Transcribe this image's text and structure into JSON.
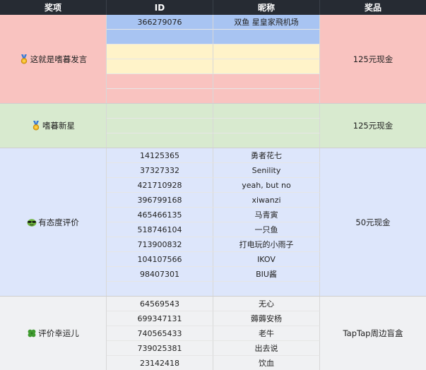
{
  "header": {
    "award": "奖项",
    "id": "ID",
    "nickname": "昵称",
    "prize": "奖品"
  },
  "colors": {
    "header_bg": "#262b33",
    "group1_bg": "#f9c3c0",
    "group2_bg": "#d8eacf",
    "group3_bg": "#dde6fb",
    "group4_bg": "#f0f1f3",
    "row_highlight_blue": "#a8c4f2",
    "row_highlight_yellow": "#fff3c9"
  },
  "groups": [
    {
      "award": "这就是嗜暮发言",
      "award_icon": "medal-icon",
      "prize": "125元现金",
      "rows": [
        {
          "id": "366279076",
          "nickname": "双鱼 星皇家飛机场"
        },
        {
          "id": "",
          "nickname": ""
        },
        {
          "id": "",
          "nickname": ""
        },
        {
          "id": "",
          "nickname": ""
        },
        {
          "id": "",
          "nickname": ""
        },
        {
          "id": "",
          "nickname": ""
        }
      ]
    },
    {
      "award": "嗜暮新星",
      "award_icon": "medal-icon",
      "prize": "125元现金",
      "rows": [
        {
          "id": "",
          "nickname": ""
        },
        {
          "id": "",
          "nickname": ""
        },
        {
          "id": "",
          "nickname": ""
        }
      ]
    },
    {
      "award": "有态度评价",
      "award_icon": "sunglasses-face-icon",
      "prize": "50元现金",
      "rows": [
        {
          "id": "14125365",
          "nickname": "勇者花七"
        },
        {
          "id": "37327332",
          "nickname": "Senility"
        },
        {
          "id": "421710928",
          "nickname": "yeah, but no"
        },
        {
          "id": "396799168",
          "nickname": "xiwanzi"
        },
        {
          "id": "465466135",
          "nickname": "马青寅"
        },
        {
          "id": "518746104",
          "nickname": "一只鱼"
        },
        {
          "id": "713900832",
          "nickname": "打电玩的小雨子"
        },
        {
          "id": "104107566",
          "nickname": "IKOV"
        },
        {
          "id": "98407301",
          "nickname": "BIU酱"
        },
        {
          "id": "",
          "nickname": ""
        }
      ]
    },
    {
      "award": "评价幸运儿",
      "award_icon": "four-leaf-clover-icon",
      "prize": "TapTap周边盲盒",
      "rows": [
        {
          "id": "64569543",
          "nickname": "无心"
        },
        {
          "id": "699347131",
          "nickname": "薅薅安杨"
        },
        {
          "id": "740565433",
          "nickname": "老牛"
        },
        {
          "id": "739025381",
          "nickname": "出去说"
        },
        {
          "id": "23142418",
          "nickname": "饮血"
        }
      ]
    }
  ]
}
